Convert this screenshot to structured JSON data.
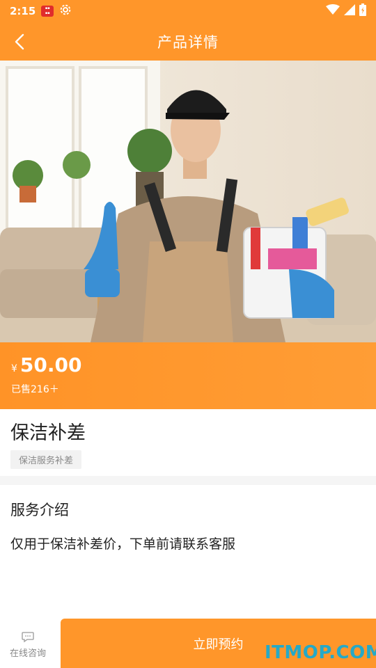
{
  "status_bar": {
    "time": "2:15",
    "icons": [
      "app-notification-icon",
      "settings-icon",
      "wifi-icon",
      "signal-icon",
      "battery-icon"
    ]
  },
  "nav": {
    "back_icon": "chevron-left-icon",
    "title": "产品详情"
  },
  "hero": {
    "image": "cleaner-with-supplies-photo"
  },
  "price": {
    "currency": "¥",
    "amount": "50.00",
    "sold": "已售216＋"
  },
  "product": {
    "title": "保洁补差",
    "tag": "保洁服务补差"
  },
  "service": {
    "heading": "服务介绍",
    "text": "仅用于保洁补差价，下单前请联系客服"
  },
  "bottom": {
    "consult_label": "在线咨询",
    "consult_icon": "chat-bubble-icon",
    "book_label": "立即预约"
  },
  "watermark": "ITMOP.COM",
  "colors": {
    "accent": "#ff962a",
    "watermark": "#25a9c7"
  }
}
